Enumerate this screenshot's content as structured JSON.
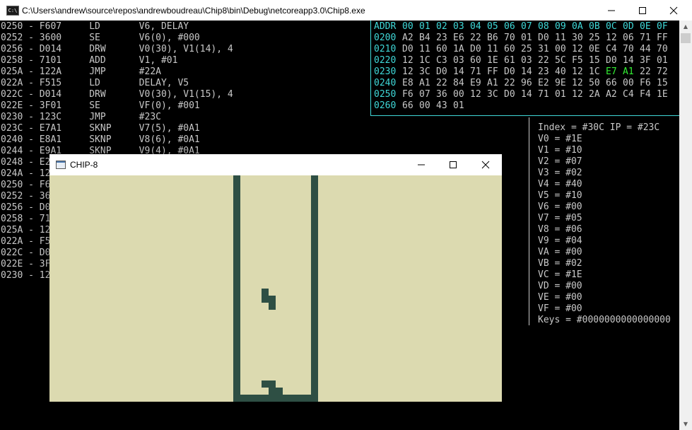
{
  "console": {
    "title": "C:\\Users\\andrew\\source\\repos\\andrewboudreau\\Chip8\\bin\\Debug\\netcoreapp3.0\\Chip8.exe",
    "icon_label": "C:\\"
  },
  "disassembly": [
    "0250 - F607     LD       V6, DELAY",
    "0252 - 3600     SE       V6(0), #000",
    "0256 - D014     DRW      V0(30), V1(14), 4",
    "0258 - 7101     ADD      V1, #01",
    "025A - 122A     JMP      #22A",
    "022A - F515     LD       DELAY, V5",
    "022C - D014     DRW      V0(30), V1(15), 4",
    "022E - 3F01     SE       VF(0), #001",
    "0230 - 123C     JMP      #23C",
    "023C - E7A1     SKNP     V7(5), #0A1",
    "0240 - E8A1     SKNP     V8(6), #0A1",
    "0244 - E9A1     SKNP     V9(4), #0A1",
    "0248 - E2",
    "024A - 12",
    "0250 - F6",
    "0252 - 36",
    "0256 - D0",
    "0258 - 71",
    "025A - 12",
    "022A - F5",
    "022C - D0",
    "022E - 3F",
    "0230 - 12"
  ],
  "memory": {
    "header": [
      "ADDR",
      "00",
      "01",
      "02",
      "03",
      "04",
      "05",
      "06",
      "07",
      "08",
      "09",
      "0A",
      "0B",
      "0C",
      "0D",
      "0E",
      "0F"
    ],
    "rows": [
      {
        "addr": "0200",
        "bytes": [
          "A2",
          "B4",
          "23",
          "E6",
          "22",
          "B6",
          "70",
          "01",
          "D0",
          "11",
          "30",
          "25",
          "12",
          "06",
          "71",
          "FF"
        ]
      },
      {
        "addr": "0210",
        "bytes": [
          "D0",
          "11",
          "60",
          "1A",
          "D0",
          "11",
          "60",
          "25",
          "31",
          "00",
          "12",
          "0E",
          "C4",
          "70",
          "44",
          "70"
        ]
      },
      {
        "addr": "0220",
        "bytes": [
          "12",
          "1C",
          "C3",
          "03",
          "60",
          "1E",
          "61",
          "03",
          "22",
          "5C",
          "F5",
          "15",
          "D0",
          "14",
          "3F",
          "01"
        ]
      },
      {
        "addr": "0230",
        "bytes": [
          "12",
          "3C",
          "D0",
          "14",
          "71",
          "FF",
          "D0",
          "14",
          "23",
          "40",
          "12",
          "1C",
          "E7",
          "A1",
          "22",
          "72"
        ]
      },
      {
        "addr": "0240",
        "bytes": [
          "E8",
          "A1",
          "22",
          "84",
          "E9",
          "A1",
          "22",
          "96",
          "E2",
          "9E",
          "12",
          "50",
          "66",
          "00",
          "F6",
          "15"
        ]
      },
      {
        "addr": "0250",
        "bytes": [
          "F6",
          "07",
          "36",
          "00",
          "12",
          "3C",
          "D0",
          "14",
          "71",
          "01",
          "12",
          "2A",
          "A2",
          "C4",
          "F4",
          "1E"
        ]
      },
      {
        "addr": "0260",
        "bytes": [
          "66",
          "00",
          "43",
          "01"
        ]
      }
    ],
    "highlight_color": "#33ee33",
    "accent_color": "#3fd8d8"
  },
  "registers": [
    "Index = #30C IP = #23C",
    "V0 = #1E",
    "V1 = #10",
    "V2 = #07",
    "V3 = #02",
    "V4 = #40",
    "V5 = #10",
    "V6 = #00",
    "V7 = #05",
    "V8 = #06",
    "V9 = #04",
    "VA = #00",
    "VB = #02",
    "VC = #1E",
    "VD = #00",
    "VE = #00",
    "VF = #00",
    "Keys = #0000000000000000"
  ],
  "chip8_window": {
    "title": "CHIP-8",
    "screen_bg": "#dcdab0",
    "pixel_color": "#2e4f44"
  },
  "icons": {
    "minimize": "minimize-icon",
    "maximize": "maximize-icon",
    "close": "close-icon",
    "scroll_up": "scroll-up-arrow-icon",
    "scroll_down": "scroll-down-arrow-icon"
  }
}
